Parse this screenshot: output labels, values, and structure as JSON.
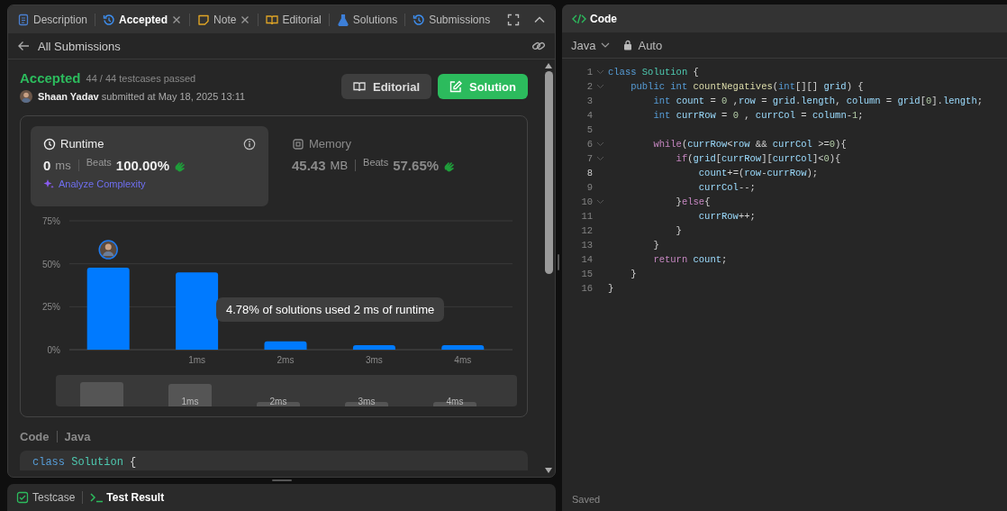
{
  "left_panel": {
    "tabs": [
      {
        "label": "Description",
        "selected": false,
        "closable": false
      },
      {
        "label": "Accepted",
        "selected": true,
        "closable": true
      },
      {
        "label": "Note",
        "selected": false,
        "closable": true
      },
      {
        "label": "Editorial",
        "selected": false,
        "closable": false
      },
      {
        "label": "Solutions",
        "selected": false,
        "closable": false
      },
      {
        "label": "Submissions",
        "selected": false,
        "closable": false
      }
    ],
    "back_link": "All Submissions",
    "submission": {
      "status": "Accepted",
      "testcases": "44 / 44 testcases passed",
      "author": "Shaan Yadav",
      "submitted": "submitted at May 18, 2025 13:11",
      "buttons": [
        {
          "label": "Editorial",
          "kind": "secondary"
        },
        {
          "label": "Solution",
          "kind": "primary"
        }
      ]
    },
    "stats": [
      {
        "title": "Runtime",
        "kind": "runtime",
        "selected": true,
        "value": "0",
        "unit": "ms",
        "beats_label": "Beats",
        "beats": "100.00%",
        "action": "Analyze Complexity"
      },
      {
        "title": "Memory",
        "kind": "memory",
        "selected": false,
        "value": "45.43",
        "unit": "MB",
        "beats_label": "Beats",
        "beats": "57.65%"
      }
    ],
    "chart_data": {
      "type": "bar",
      "categories": [
        null,
        "1ms",
        "2ms",
        "3ms",
        "4ms"
      ],
      "series": [
        {
          "color": "#007aff",
          "values": [
            47.7,
            45.0,
            4.8,
            2.6,
            2.6
          ]
        }
      ],
      "ylim": [
        0,
        75
      ],
      "yticks": [
        {
          "value": 0,
          "label": "0%"
        },
        {
          "value": 25,
          "label": "25%"
        },
        {
          "value": 50,
          "label": "50%"
        },
        {
          "value": 75,
          "label": "75%"
        }
      ]
    },
    "tooltip": "4.78% of solutions used 2 ms of runtime",
    "navigator_labels": [
      "1ms",
      "2ms",
      "3ms",
      "4ms"
    ],
    "code_header": {
      "label": "Code",
      "language": "Java"
    },
    "code_preview": [
      [
        {
          "text": "class ",
          "kind": "kw"
        },
        {
          "text": "Solution ",
          "kind": "cls"
        },
        {
          "text": "{",
          "kind": "p"
        }
      ]
    ],
    "bottom_tabs": [
      {
        "label": "Testcase",
        "selected": false
      },
      {
        "label": "Test Result",
        "selected": true
      }
    ]
  },
  "code_panel": {
    "title": "Code",
    "language": "Java",
    "mode": "Auto",
    "status": "Saved",
    "lines": [
      {
        "number": "1",
        "fold": true,
        "current": false,
        "tokens": [
          {
            "text": "class ",
            "kind": "kw"
          },
          {
            "text": "Solution ",
            "kind": "cls"
          },
          {
            "text": "{",
            "kind": "p"
          }
        ]
      },
      {
        "number": "2",
        "fold": true,
        "current": false,
        "tokens": [
          {
            "text": "    public int ",
            "kind": "kw"
          },
          {
            "text": "countNegatives",
            "kind": "fn"
          },
          {
            "text": "(",
            "kind": "p"
          },
          {
            "text": "int",
            "kind": "kw"
          },
          {
            "text": "[][] ",
            "kind": "p"
          },
          {
            "text": "grid",
            "kind": "var"
          },
          {
            "text": ") {",
            "kind": "p"
          }
        ]
      },
      {
        "number": "3",
        "fold": false,
        "current": false,
        "tokens": [
          {
            "text": "        int ",
            "kind": "kw"
          },
          {
            "text": "count",
            "kind": "var"
          },
          {
            "text": " = ",
            "kind": "p"
          },
          {
            "text": "0",
            "kind": "num"
          },
          {
            "text": " ,",
            "kind": "p"
          },
          {
            "text": "row",
            "kind": "var"
          },
          {
            "text": " = ",
            "kind": "p"
          },
          {
            "text": "grid",
            "kind": "var"
          },
          {
            "text": ".",
            "kind": "p"
          },
          {
            "text": "length",
            "kind": "var"
          },
          {
            "text": ", ",
            "kind": "p"
          },
          {
            "text": "column",
            "kind": "var"
          },
          {
            "text": " = ",
            "kind": "p"
          },
          {
            "text": "grid",
            "kind": "var"
          },
          {
            "text": "[",
            "kind": "p"
          },
          {
            "text": "0",
            "kind": "num"
          },
          {
            "text": "].",
            "kind": "p"
          },
          {
            "text": "length",
            "kind": "var"
          },
          {
            "text": ";",
            "kind": "p"
          }
        ]
      },
      {
        "number": "4",
        "fold": false,
        "current": false,
        "tokens": [
          {
            "text": "        int ",
            "kind": "kw"
          },
          {
            "text": "currRow",
            "kind": "var"
          },
          {
            "text": " = ",
            "kind": "p"
          },
          {
            "text": "0",
            "kind": "num"
          },
          {
            "text": " , ",
            "kind": "p"
          },
          {
            "text": "currCol",
            "kind": "var"
          },
          {
            "text": " = ",
            "kind": "p"
          },
          {
            "text": "column",
            "kind": "var"
          },
          {
            "text": "-",
            "kind": "p"
          },
          {
            "text": "1",
            "kind": "num"
          },
          {
            "text": ";",
            "kind": "p"
          }
        ]
      },
      {
        "number": "5",
        "fold": false,
        "current": false
      },
      {
        "number": "6",
        "fold": true,
        "current": false,
        "tokens": [
          {
            "text": "        while",
            "kind": "ctl"
          },
          {
            "text": "(",
            "kind": "p"
          },
          {
            "text": "currRow",
            "kind": "var"
          },
          {
            "text": "<",
            "kind": "p"
          },
          {
            "text": "row",
            "kind": "var"
          },
          {
            "text": " && ",
            "kind": "p"
          },
          {
            "text": "currCol",
            "kind": "var"
          },
          {
            "text": " >=",
            "kind": "p"
          },
          {
            "text": "0",
            "kind": "num"
          },
          {
            "text": "){",
            "kind": "p"
          }
        ]
      },
      {
        "number": "7",
        "fold": true,
        "current": false,
        "tokens": [
          {
            "text": "            if",
            "kind": "ctl"
          },
          {
            "text": "(",
            "kind": "p"
          },
          {
            "text": "grid",
            "kind": "var"
          },
          {
            "text": "[",
            "kind": "p"
          },
          {
            "text": "currRow",
            "kind": "var"
          },
          {
            "text": "][",
            "kind": "p"
          },
          {
            "text": "currCol",
            "kind": "var"
          },
          {
            "text": "]<",
            "kind": "p"
          },
          {
            "text": "0",
            "kind": "num"
          },
          {
            "text": "){",
            "kind": "p"
          }
        ]
      },
      {
        "number": "8",
        "fold": false,
        "current": true,
        "tokens": [
          {
            "text": "                count",
            "kind": "var"
          },
          {
            "text": "+=(",
            "kind": "p"
          },
          {
            "text": "row",
            "kind": "var"
          },
          {
            "text": "-",
            "kind": "p"
          },
          {
            "text": "currRow",
            "kind": "var"
          },
          {
            "text": ");",
            "kind": "p"
          }
        ]
      },
      {
        "number": "9",
        "fold": false,
        "current": false,
        "tokens": [
          {
            "text": "                currCol",
            "kind": "var"
          },
          {
            "text": "--;",
            "kind": "p"
          }
        ]
      },
      {
        "number": "10",
        "fold": true,
        "current": false,
        "tokens": [
          {
            "text": "            }",
            "kind": "p"
          },
          {
            "text": "else",
            "kind": "ctl"
          },
          {
            "text": "{",
            "kind": "p"
          }
        ]
      },
      {
        "number": "11",
        "fold": false,
        "current": false,
        "tokens": [
          {
            "text": "                currRow",
            "kind": "var"
          },
          {
            "text": "++;",
            "kind": "p"
          }
        ]
      },
      {
        "number": "12",
        "fold": false,
        "current": false,
        "tokens": [
          {
            "text": "            }",
            "kind": "p"
          }
        ]
      },
      {
        "number": "13",
        "fold": false,
        "current": false,
        "tokens": [
          {
            "text": "        }",
            "kind": "p"
          }
        ]
      },
      {
        "number": "14",
        "fold": false,
        "current": false,
        "tokens": [
          {
            "text": "        return ",
            "kind": "ctl"
          },
          {
            "text": "count",
            "kind": "var"
          },
          {
            "text": ";",
            "kind": "p"
          }
        ]
      },
      {
        "number": "15",
        "fold": false,
        "current": false,
        "tokens": [
          {
            "text": "    }",
            "kind": "p"
          }
        ]
      },
      {
        "number": "16",
        "fold": false,
        "current": false,
        "tokens": [
          {
            "text": "}",
            "kind": "p"
          }
        ]
      }
    ]
  }
}
